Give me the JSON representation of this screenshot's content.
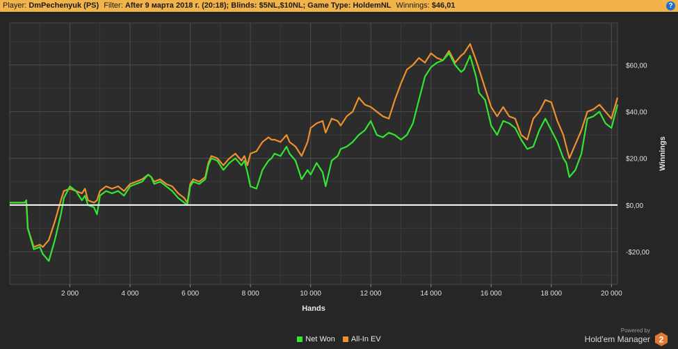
{
  "header": {
    "player_label": "Player:",
    "player_value": "DmPechenyuk (PS)",
    "filter_label": "Filter:",
    "filter_value": "After 9 марта 2018 г. (20:18); Blinds: $5NL,$10NL; Game Type: HoldemNL",
    "winnings_label": "Winnings:",
    "winnings_value": "$46,01",
    "help_text": "?",
    "bar_color": "#f2b44a"
  },
  "branding": {
    "powered_by": "Powered by",
    "product": "Hold'em Manager",
    "logo_text": "2"
  },
  "chart_data": {
    "type": "line",
    "xlabel": "Hands",
    "ylabel": "Winnings",
    "xlim": [
      0,
      20200
    ],
    "ylim": [
      -34,
      78
    ],
    "xticks": [
      2000,
      4000,
      6000,
      8000,
      10000,
      12000,
      14000,
      16000,
      18000,
      20000
    ],
    "xtick_labels": [
      "2 000",
      "4 000",
      "6 000",
      "8 000",
      "10 000",
      "12 000",
      "14 000",
      "16 000",
      "18 000",
      "20 000"
    ],
    "yticks": [
      -20,
      0,
      20,
      40,
      60
    ],
    "ytick_labels": [
      "-$20,00",
      "$0,00",
      "$20,00",
      "$40,00",
      "$60,00"
    ],
    "grid": true,
    "legend_position": "bottom-center",
    "zero_line_color": "#ffffff",
    "series": [
      {
        "name": "Net Won",
        "color": "#33e633",
        "x": [
          0,
          500,
          550,
          600,
          800,
          1000,
          1100,
          1300,
          1500,
          1700,
          1800,
          2000,
          2200,
          2400,
          2500,
          2600,
          2800,
          2900,
          3000,
          3200,
          3400,
          3600,
          3800,
          4000,
          4200,
          4400,
          4600,
          4700,
          4800,
          5000,
          5200,
          5400,
          5600,
          5800,
          5900,
          6000,
          6100,
          6300,
          6500,
          6600,
          6700,
          6900,
          7100,
          7300,
          7500,
          7700,
          7800,
          7900,
          8000,
          8200,
          8400,
          8600,
          8700,
          8800,
          9000,
          9200,
          9300,
          9500,
          9700,
          9900,
          10000,
          10200,
          10400,
          10500,
          10700,
          10900,
          11000,
          11200,
          11400,
          11600,
          11800,
          12000,
          12200,
          12400,
          12600,
          12800,
          13000,
          13200,
          13400,
          13600,
          13800,
          14000,
          14200,
          14400,
          14600,
          14800,
          15000,
          15100,
          15300,
          15500,
          15600,
          15800,
          16000,
          16200,
          16400,
          16600,
          16800,
          17000,
          17200,
          17400,
          17600,
          17800,
          18000,
          18200,
          18400,
          18500,
          18600,
          18800,
          19000,
          19200,
          19400,
          19600,
          19800,
          20000,
          20200
        ],
        "values": [
          1,
          1,
          2,
          -10,
          -19,
          -18,
          -21,
          -24,
          -15,
          -4,
          3,
          8,
          6,
          2,
          4,
          0,
          -1,
          -4,
          4,
          6,
          5,
          6,
          4,
          8,
          9,
          10,
          13,
          12,
          9,
          10,
          8,
          6,
          3,
          1,
          0,
          8,
          10,
          9,
          11,
          17,
          20,
          19,
          15,
          18,
          20,
          17,
          19,
          14,
          8,
          7,
          15,
          19,
          20,
          22,
          21,
          25,
          22,
          19,
          11,
          15,
          13,
          18,
          14,
          8,
          19,
          21,
          24,
          25,
          27,
          30,
          32,
          36,
          30,
          29,
          31,
          30,
          28,
          30,
          35,
          45,
          55,
          59,
          61,
          62,
          65,
          60,
          57,
          58,
          64,
          55,
          48,
          45,
          34,
          30,
          36,
          35,
          33,
          28,
          24,
          25,
          32,
          37,
          32,
          27,
          20,
          18,
          12,
          15,
          22,
          37,
          38,
          40,
          35,
          33,
          43
        ]
      },
      {
        "name": "All-In EV",
        "color": "#f0902e",
        "x": [
          0,
          500,
          550,
          600,
          800,
          1000,
          1100,
          1300,
          1500,
          1700,
          1800,
          2000,
          2200,
          2400,
          2500,
          2600,
          2800,
          2900,
          3000,
          3200,
          3400,
          3600,
          3800,
          4000,
          4200,
          4400,
          4600,
          4700,
          4800,
          5000,
          5200,
          5400,
          5600,
          5800,
          5900,
          6000,
          6100,
          6300,
          6500,
          6600,
          6700,
          6900,
          7100,
          7300,
          7500,
          7700,
          7800,
          7900,
          8000,
          8200,
          8400,
          8600,
          8700,
          8800,
          9000,
          9200,
          9300,
          9500,
          9700,
          9900,
          10000,
          10200,
          10400,
          10500,
          10700,
          10900,
          11000,
          11200,
          11400,
          11600,
          11800,
          12000,
          12200,
          12400,
          12600,
          12800,
          13000,
          13200,
          13400,
          13600,
          13800,
          14000,
          14200,
          14400,
          14600,
          14800,
          15000,
          15100,
          15300,
          15500,
          15600,
          15800,
          16000,
          16200,
          16400,
          16600,
          16800,
          17000,
          17200,
          17400,
          17600,
          17800,
          18000,
          18200,
          18400,
          18500,
          18600,
          18800,
          19000,
          19200,
          19400,
          19600,
          19800,
          20000,
          20200
        ],
        "values": [
          1,
          1,
          2,
          -10,
          -18,
          -17,
          -18,
          -15,
          -7,
          2,
          6,
          7,
          6,
          5,
          7,
          2,
          1,
          2,
          6,
          8,
          7,
          8,
          6,
          9,
          10,
          11,
          13,
          12,
          10,
          11,
          9,
          8,
          5,
          3,
          1,
          9,
          11,
          10,
          12,
          18,
          21,
          20,
          17,
          20,
          22,
          19,
          21,
          17,
          22,
          23,
          27,
          29,
          28,
          28,
          27,
          30,
          27,
          25,
          21,
          27,
          33,
          35,
          36,
          31,
          37,
          36,
          34,
          38,
          40,
          46,
          43,
          42,
          40,
          38,
          37,
          45,
          52,
          58,
          60,
          63,
          61,
          65,
          63,
          62,
          66,
          61,
          64,
          65,
          69,
          62,
          58,
          50,
          42,
          38,
          42,
          38,
          37,
          30,
          28,
          37,
          40,
          45,
          44,
          36,
          30,
          25,
          20,
          26,
          32,
          40,
          41,
          43,
          40,
          37,
          46
        ]
      }
    ]
  }
}
